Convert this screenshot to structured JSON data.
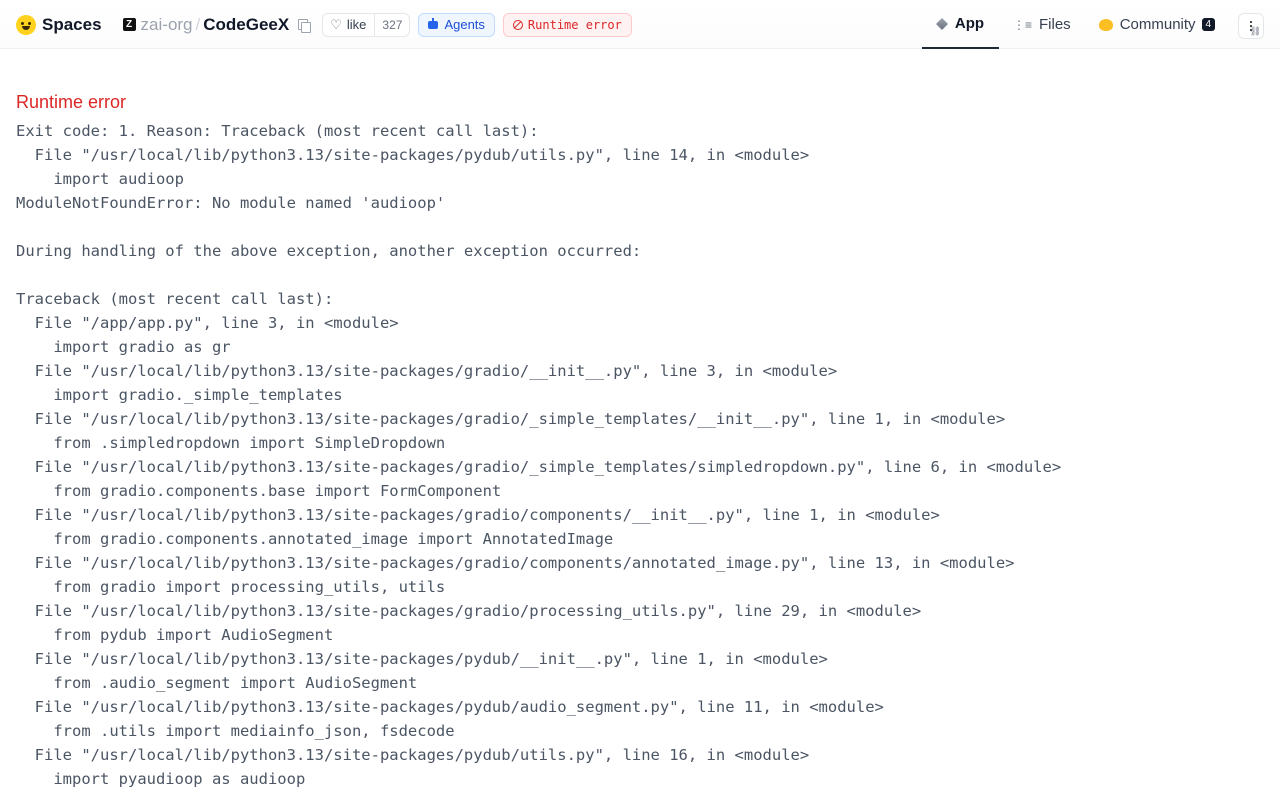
{
  "header": {
    "brand": "Spaces",
    "org_avatar": "Z",
    "org": "zai-org",
    "separator": "/",
    "repo": "CodeGeeX",
    "like_label": "like",
    "like_count": "327",
    "agents_label": "Agents",
    "status_label": "Runtime error",
    "status_color": "#dc2626",
    "icons": {
      "logo": "hugging-face-logo",
      "copy": "copy-icon",
      "like": "heart-icon",
      "agents": "robot-icon",
      "status": "error-circle-icon",
      "menu": "more-vertical-icon"
    }
  },
  "tabs": [
    {
      "label": "App",
      "icon": "cube-icon"
    },
    {
      "label": "Files",
      "icon": "files-icon"
    },
    {
      "label": "Community",
      "icon": "community-icon",
      "count": "4"
    }
  ],
  "main": {
    "error_title": "Runtime error",
    "traceback_lines": [
      "Exit code: 1. Reason: Traceback (most recent call last):",
      "  File \"/usr/local/lib/python3.13/site-packages/pydub/utils.py\", line 14, in <module>",
      "    import audioop",
      "ModuleNotFoundError: No module named 'audioop'",
      "",
      "During handling of the above exception, another exception occurred:",
      "",
      "Traceback (most recent call last):",
      "  File \"/app/app.py\", line 3, in <module>",
      "    import gradio as gr",
      "  File \"/usr/local/lib/python3.13/site-packages/gradio/__init__.py\", line 3, in <module>",
      "    import gradio._simple_templates",
      "  File \"/usr/local/lib/python3.13/site-packages/gradio/_simple_templates/__init__.py\", line 1, in <module>",
      "    from .simpledropdown import SimpleDropdown",
      "  File \"/usr/local/lib/python3.13/site-packages/gradio/_simple_templates/simpledropdown.py\", line 6, in <module>",
      "    from gradio.components.base import FormComponent",
      "  File \"/usr/local/lib/python3.13/site-packages/gradio/components/__init__.py\", line 1, in <module>",
      "    from gradio.components.annotated_image import AnnotatedImage",
      "  File \"/usr/local/lib/python3.13/site-packages/gradio/components/annotated_image.py\", line 13, in <module>",
      "    from gradio import processing_utils, utils",
      "  File \"/usr/local/lib/python3.13/site-packages/gradio/processing_utils.py\", line 29, in <module>",
      "    from pydub import AudioSegment",
      "  File \"/usr/local/lib/python3.13/site-packages/pydub/__init__.py\", line 1, in <module>",
      "    from .audio_segment import AudioSegment",
      "  File \"/usr/local/lib/python3.13/site-packages/pydub/audio_segment.py\", line 11, in <module>",
      "    from .utils import mediainfo_json, fsdecode",
      "  File \"/usr/local/lib/python3.13/site-packages/pydub/utils.py\", line 16, in <module>",
      "    import pyaudioop as audioop"
    ]
  }
}
